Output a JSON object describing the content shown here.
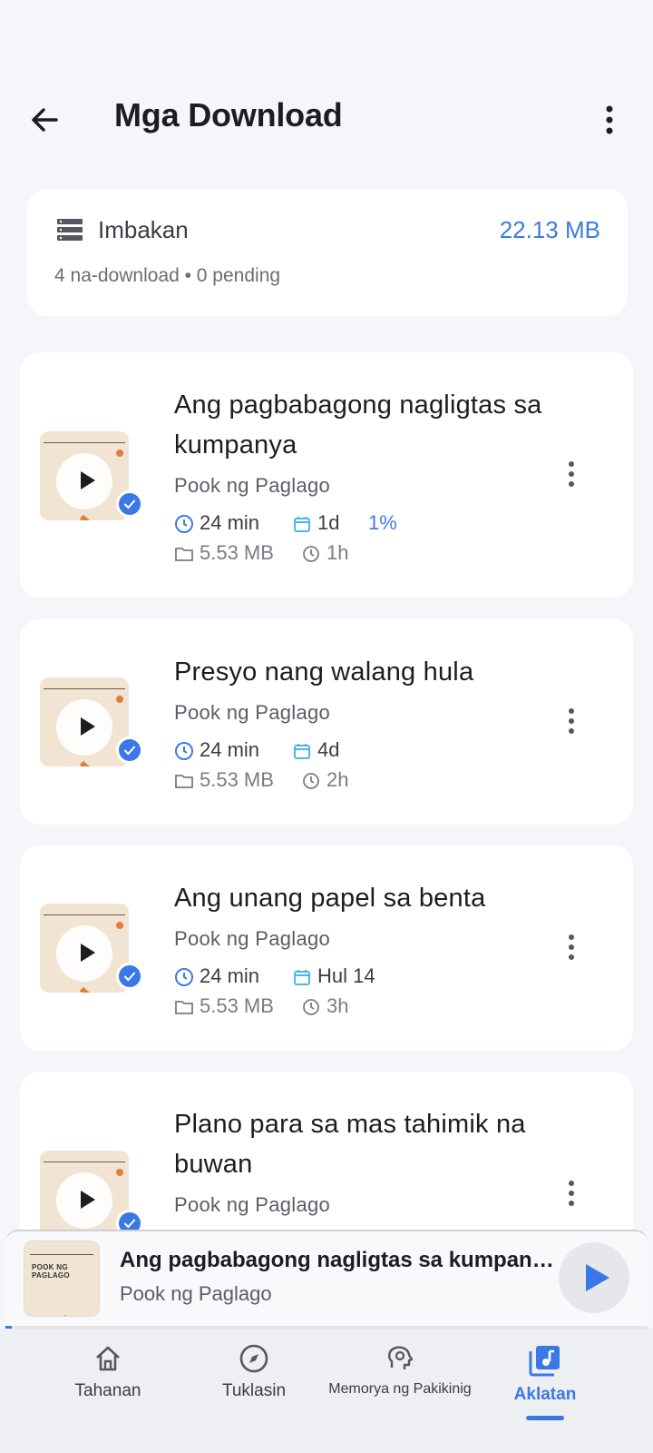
{
  "header": {
    "title": "Mga Download"
  },
  "storage": {
    "label": "Imbakan",
    "size": "22.13 MB",
    "summary": "4 na-download • 0 pending"
  },
  "episodes": [
    {
      "title": "Ang pagbabagong nagligtas sa kumpanya",
      "source": "Pook ng Paglago",
      "duration": "24 min",
      "date": "1d",
      "progress": "1%",
      "size": "5.53 MB",
      "time": "1h"
    },
    {
      "title": "Presyo nang walang hula",
      "source": "Pook ng Paglago",
      "duration": "24 min",
      "date": "4d",
      "size": "5.53 MB",
      "time": "2h"
    },
    {
      "title": "Ang unang papel sa benta",
      "source": "Pook ng Paglago",
      "duration": "24 min",
      "date": "Hul 14",
      "size": "5.53 MB",
      "time": "3h"
    },
    {
      "title": "Plano para sa mas tahimik na buwan",
      "source": "Pook ng Paglago"
    }
  ],
  "mini_player": {
    "title": "Ang pagbabagong nagligtas sa kumpanya",
    "source": "Pook ng Paglago",
    "cover_text": "POOK NG PAGLAGO",
    "progress": 0.01
  },
  "nav": [
    {
      "label": "Tahanan",
      "icon": "home-icon"
    },
    {
      "label": "Tuklasin",
      "icon": "compass-icon"
    },
    {
      "label": "Memorya ng Pakikinig",
      "icon": "brain-icon"
    },
    {
      "label": "Aklatan",
      "icon": "library-icon",
      "active": true
    }
  ],
  "colors": {
    "accent": "#3a78e6",
    "cover_orange": "#e07f3a",
    "cover_bg": "#f1e4d2"
  }
}
